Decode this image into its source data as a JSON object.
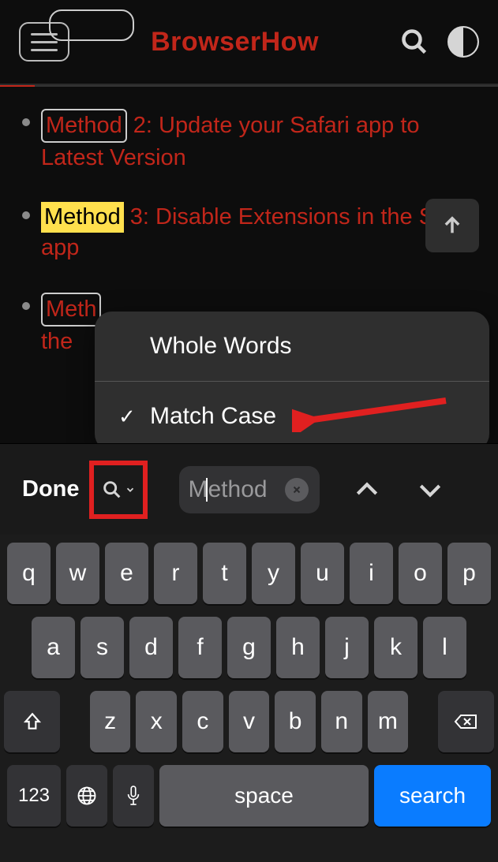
{
  "header": {
    "logo": "BrowserHow"
  },
  "content": {
    "items": [
      {
        "highlight": "Method",
        "highlight_style": "box",
        "rest": " 2: Update your Safari app to Latest Version"
      },
      {
        "highlight": "Method",
        "highlight_style": "active",
        "rest": " 3: Disable Extensions in the Safari app"
      },
      {
        "highlight": "Meth",
        "highlight_style": "box",
        "line1_rest": "",
        "line2": "the "
      }
    ]
  },
  "popup": {
    "opt1": "Whole Words",
    "opt2": "Match Case",
    "opt2_checked": "✓"
  },
  "findbar": {
    "done": "Done",
    "placeholder": "Method"
  },
  "keyboard": {
    "row1": [
      "q",
      "w",
      "e",
      "r",
      "t",
      "y",
      "u",
      "i",
      "o",
      "p"
    ],
    "row2": [
      "a",
      "s",
      "d",
      "f",
      "g",
      "h",
      "j",
      "k",
      "l"
    ],
    "row3": [
      "z",
      "x",
      "c",
      "v",
      "b",
      "n",
      "m"
    ],
    "numKey": "123",
    "space": "space",
    "search": "search"
  }
}
